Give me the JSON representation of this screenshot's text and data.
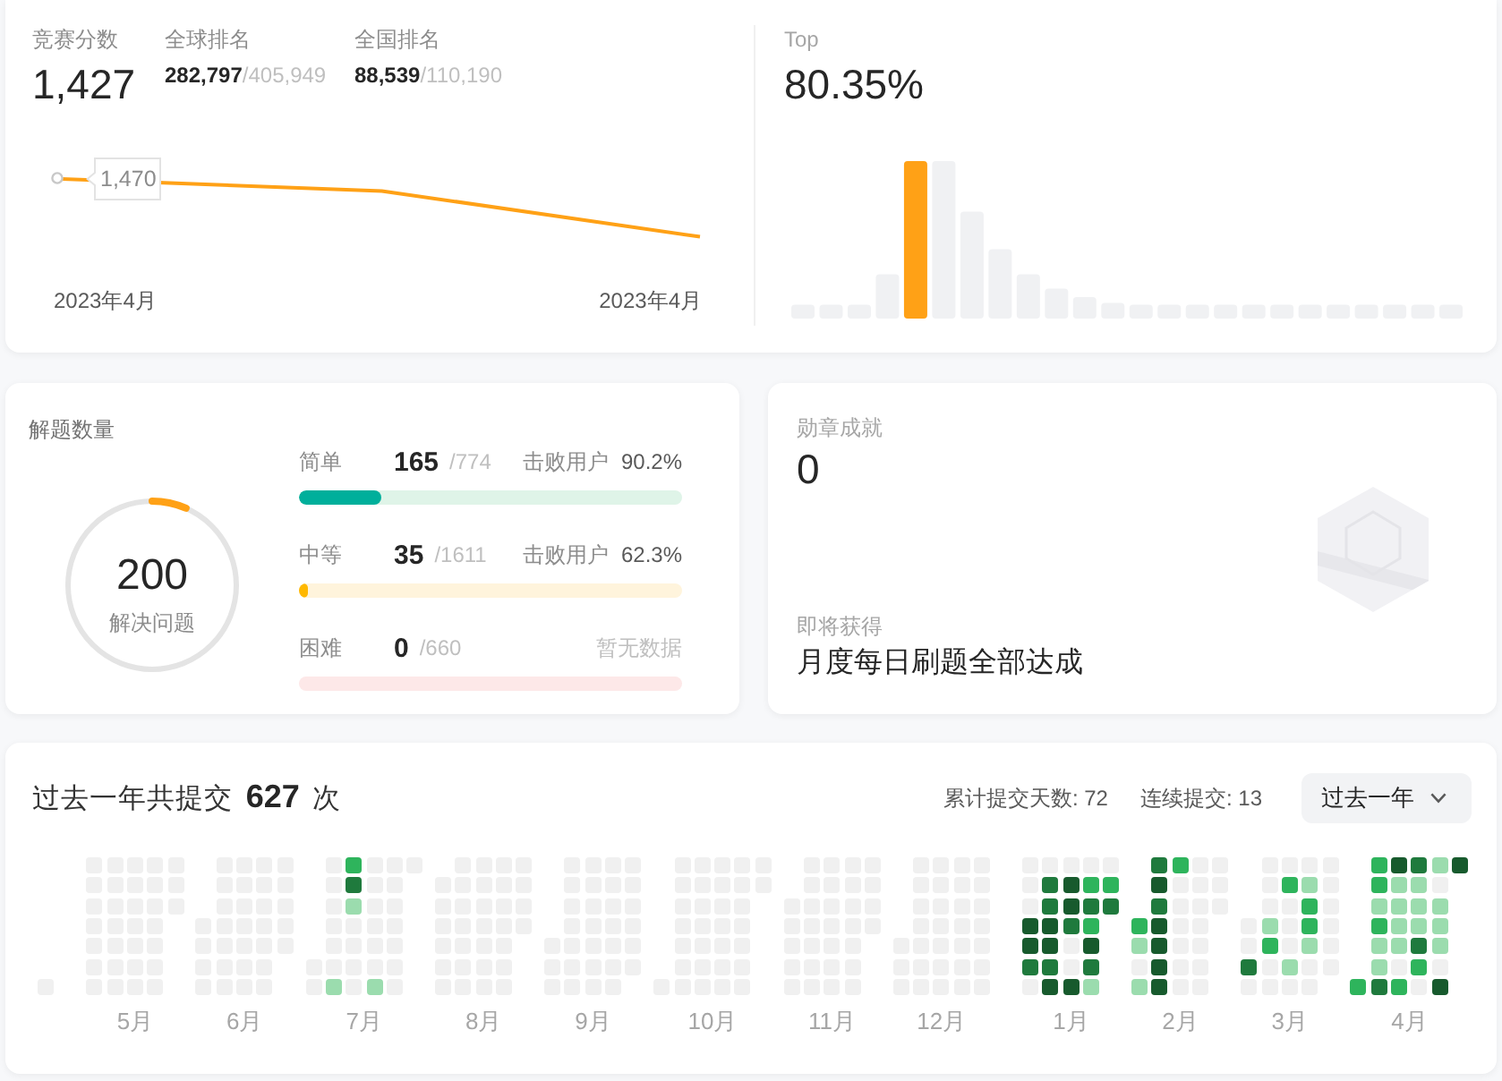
{
  "rating": {
    "label": "竞赛分数",
    "value": "1,427",
    "global_rank": {
      "label": "全球排名",
      "value": "**282,797**/405,949"
    },
    "national_rank": {
      "label": "全国排名",
      "value": "**88,539**/110,190"
    },
    "chart": {
      "tooltip": "1,470",
      "x_labels": [
        "2023年4月",
        "2023年4月"
      ]
    }
  },
  "top_percent": {
    "label": "Top",
    "value": "80.35%"
  },
  "solved": {
    "title": "解题数量",
    "count": "200",
    "caption": "解决问题",
    "level": 0.066,
    "difficulties": [
      {
        "kind": "easy",
        "label": "简单",
        "count": "165",
        "total": "/774",
        "beats_label": "击败用户",
        "beats": "90.2%",
        "level": 0.213
      },
      {
        "kind": "medium",
        "label": "中等",
        "count": "35",
        "total": "/1611",
        "beats_label": "击败用户",
        "beats": "62.3%",
        "level": 0.022
      },
      {
        "kind": "hard",
        "label": "困难",
        "count": "0",
        "total": "/660",
        "no_data": "暂无数据"
      }
    ]
  },
  "badges": {
    "title": "勋章成就",
    "count": "0",
    "upcoming_label": "即将获得",
    "upcoming": "月度每日刷题全部达成"
  },
  "submissions": {
    "title": "过去一年共提交 **627** 次",
    "total_days": "累计提交天数: 72",
    "streak": "连续提交: 13",
    "range": "过去一年",
    "months": [
      {
        "weeks": [
          [
            {
              "color": "#f0f0f0"
            }
          ]
        ]
      },
      {
        "label": "5月",
        "weeks": [
          [
            {
              "color": "#f0f0f0"
            },
            {
              "color": "#f0f0f0"
            },
            {
              "color": "#f0f0f0"
            },
            {
              "color": "#f0f0f0"
            },
            {
              "color": "#f0f0f0"
            },
            {
              "color": "#f0f0f0"
            },
            {
              "color": "#f0f0f0"
            }
          ],
          [
            {
              "color": "#f0f0f0"
            },
            {
              "color": "#f0f0f0"
            },
            {
              "color": "#f0f0f0"
            },
            {
              "color": "#f0f0f0"
            },
            {
              "color": "#f0f0f0"
            },
            {
              "color": "#f0f0f0"
            },
            {
              "color": "#f0f0f0"
            }
          ],
          [
            {
              "color": "#f0f0f0"
            },
            {
              "color": "#f0f0f0"
            },
            {
              "color": "#f0f0f0"
            },
            {
              "color": "#f0f0f0"
            },
            {
              "color": "#f0f0f0"
            },
            {
              "color": "#f0f0f0"
            },
            {
              "color": "#f0f0f0"
            }
          ],
          [
            {
              "color": "#f0f0f0"
            },
            {
              "color": "#f0f0f0"
            },
            {
              "color": "#f0f0f0"
            },
            {
              "color": "#f0f0f0"
            },
            {
              "color": "#f0f0f0"
            },
            {
              "color": "#f0f0f0"
            },
            {
              "color": "#f0f0f0"
            }
          ],
          [
            {
              "color": "#f0f0f0"
            },
            {
              "color": "#f0f0f0"
            },
            {
              "color": "#f0f0f0"
            }
          ]
        ]
      },
      {
        "label": "6月",
        "weeks": [
          [
            {
              "color": "#f0f0f0"
            },
            {
              "color": "#f0f0f0"
            },
            {
              "color": "#f0f0f0"
            },
            {
              "color": "#f0f0f0"
            }
          ],
          [
            {
              "color": "#f0f0f0"
            },
            {
              "color": "#f0f0f0"
            },
            {
              "color": "#f0f0f0"
            },
            {
              "color": "#f0f0f0"
            },
            {
              "color": "#f0f0f0"
            },
            {
              "color": "#f0f0f0"
            },
            {
              "color": "#f0f0f0"
            }
          ],
          [
            {
              "color": "#f0f0f0"
            },
            {
              "color": "#f0f0f0"
            },
            {
              "color": "#f0f0f0"
            },
            {
              "color": "#f0f0f0"
            },
            {
              "color": "#f0f0f0"
            },
            {
              "color": "#f0f0f0"
            },
            {
              "color": "#f0f0f0"
            }
          ],
          [
            {
              "color": "#f0f0f0"
            },
            {
              "color": "#f0f0f0"
            },
            {
              "color": "#f0f0f0"
            },
            {
              "color": "#f0f0f0"
            },
            {
              "color": "#f0f0f0"
            },
            {
              "color": "#f0f0f0"
            },
            {
              "color": "#f0f0f0"
            }
          ],
          [
            {
              "color": "#f0f0f0"
            },
            {
              "color": "#f0f0f0"
            },
            {
              "color": "#f0f0f0"
            },
            {
              "color": "#f0f0f0"
            },
            {
              "color": "#f0f0f0"
            }
          ]
        ]
      },
      {
        "label": "7月",
        "weeks": [
          [
            {
              "color": "#f0f0f0"
            },
            {
              "color": "#f0f0f0"
            }
          ],
          [
            {
              "color": "#f0f0f0"
            },
            {
              "color": "#f0f0f0"
            },
            {
              "color": "#f0f0f0"
            },
            {
              "color": "#f0f0f0"
            },
            {
              "color": "#f0f0f0"
            },
            {
              "color": "#f0f0f0"
            },
            {
              "color": "#9bdcae"
            }
          ],
          [
            {
              "color": "#2eb45c"
            },
            {
              "color": "#1f7a3d"
            },
            {
              "color": "#9bdcae"
            },
            {
              "color": "#f0f0f0"
            },
            {
              "color": "#f0f0f0"
            },
            {
              "color": "#f0f0f0"
            },
            {
              "color": "#f0f0f0"
            }
          ],
          [
            {
              "color": "#f0f0f0"
            },
            {
              "color": "#f0f0f0"
            },
            {
              "color": "#f0f0f0"
            },
            {
              "color": "#f0f0f0"
            },
            {
              "color": "#f0f0f0"
            },
            {
              "color": "#f0f0f0"
            },
            {
              "color": "#9bdcae"
            }
          ],
          [
            {
              "color": "#f0f0f0"
            },
            {
              "color": "#f0f0f0"
            },
            {
              "color": "#f0f0f0"
            },
            {
              "color": "#f0f0f0"
            },
            {
              "color": "#f0f0f0"
            },
            {
              "color": "#f0f0f0"
            },
            {
              "color": "#f0f0f0"
            }
          ],
          [
            {
              "color": "#f0f0f0"
            }
          ]
        ]
      },
      {
        "label": "8月",
        "weeks": [
          [
            {
              "color": "#f0f0f0"
            },
            {
              "color": "#f0f0f0"
            },
            {
              "color": "#f0f0f0"
            },
            {
              "color": "#f0f0f0"
            },
            {
              "color": "#f0f0f0"
            },
            {
              "color": "#f0f0f0"
            }
          ],
          [
            {
              "color": "#f0f0f0"
            },
            {
              "color": "#f0f0f0"
            },
            {
              "color": "#f0f0f0"
            },
            {
              "color": "#f0f0f0"
            },
            {
              "color": "#f0f0f0"
            },
            {
              "color": "#f0f0f0"
            },
            {
              "color": "#f0f0f0"
            }
          ],
          [
            {
              "color": "#f0f0f0"
            },
            {
              "color": "#f0f0f0"
            },
            {
              "color": "#f0f0f0"
            },
            {
              "color": "#f0f0f0"
            },
            {
              "color": "#f0f0f0"
            },
            {
              "color": "#f0f0f0"
            },
            {
              "color": "#f0f0f0"
            }
          ],
          [
            {
              "color": "#f0f0f0"
            },
            {
              "color": "#f0f0f0"
            },
            {
              "color": "#f0f0f0"
            },
            {
              "color": "#f0f0f0"
            },
            {
              "color": "#f0f0f0"
            },
            {
              "color": "#f0f0f0"
            },
            {
              "color": "#f0f0f0"
            }
          ],
          [
            {
              "color": "#f0f0f0"
            },
            {
              "color": "#f0f0f0"
            },
            {
              "color": "#f0f0f0"
            },
            {
              "color": "#f0f0f0"
            }
          ]
        ]
      },
      {
        "label": "9月",
        "weeks": [
          [
            {
              "color": "#f0f0f0"
            },
            {
              "color": "#f0f0f0"
            },
            {
              "color": "#f0f0f0"
            }
          ],
          [
            {
              "color": "#f0f0f0"
            },
            {
              "color": "#f0f0f0"
            },
            {
              "color": "#f0f0f0"
            },
            {
              "color": "#f0f0f0"
            },
            {
              "color": "#f0f0f0"
            },
            {
              "color": "#f0f0f0"
            },
            {
              "color": "#f0f0f0"
            }
          ],
          [
            {
              "color": "#f0f0f0"
            },
            {
              "color": "#f0f0f0"
            },
            {
              "color": "#f0f0f0"
            },
            {
              "color": "#f0f0f0"
            },
            {
              "color": "#f0f0f0"
            },
            {
              "color": "#f0f0f0"
            },
            {
              "color": "#f0f0f0"
            }
          ],
          [
            {
              "color": "#f0f0f0"
            },
            {
              "color": "#f0f0f0"
            },
            {
              "color": "#f0f0f0"
            },
            {
              "color": "#f0f0f0"
            },
            {
              "color": "#f0f0f0"
            },
            {
              "color": "#f0f0f0"
            },
            {
              "color": "#f0f0f0"
            }
          ],
          [
            {
              "color": "#f0f0f0"
            },
            {
              "color": "#f0f0f0"
            },
            {
              "color": "#f0f0f0"
            },
            {
              "color": "#f0f0f0"
            },
            {
              "color": "#f0f0f0"
            },
            {
              "color": "#f0f0f0"
            }
          ]
        ]
      },
      {
        "label": "10月",
        "weeks": [
          [
            {
              "color": "#f0f0f0"
            }
          ],
          [
            {
              "color": "#f0f0f0"
            },
            {
              "color": "#f0f0f0"
            },
            {
              "color": "#f0f0f0"
            },
            {
              "color": "#f0f0f0"
            },
            {
              "color": "#f0f0f0"
            },
            {
              "color": "#f0f0f0"
            },
            {
              "color": "#f0f0f0"
            }
          ],
          [
            {
              "color": "#f0f0f0"
            },
            {
              "color": "#f0f0f0"
            },
            {
              "color": "#f0f0f0"
            },
            {
              "color": "#f0f0f0"
            },
            {
              "color": "#f0f0f0"
            },
            {
              "color": "#f0f0f0"
            },
            {
              "color": "#f0f0f0"
            }
          ],
          [
            {
              "color": "#f0f0f0"
            },
            {
              "color": "#f0f0f0"
            },
            {
              "color": "#f0f0f0"
            },
            {
              "color": "#f0f0f0"
            },
            {
              "color": "#f0f0f0"
            },
            {
              "color": "#f0f0f0"
            },
            {
              "color": "#f0f0f0"
            }
          ],
          [
            {
              "color": "#f0f0f0"
            },
            {
              "color": "#f0f0f0"
            },
            {
              "color": "#f0f0f0"
            },
            {
              "color": "#f0f0f0"
            },
            {
              "color": "#f0f0f0"
            },
            {
              "color": "#f0f0f0"
            },
            {
              "color": "#f0f0f0"
            }
          ],
          [
            {
              "color": "#f0f0f0"
            },
            {
              "color": "#f0f0f0"
            }
          ]
        ]
      },
      {
        "label": "11月",
        "weeks": [
          [
            {
              "color": "#f0f0f0"
            },
            {
              "color": "#f0f0f0"
            },
            {
              "color": "#f0f0f0"
            },
            {
              "color": "#f0f0f0"
            },
            {
              "color": "#f0f0f0"
            }
          ],
          [
            {
              "color": "#f0f0f0"
            },
            {
              "color": "#f0f0f0"
            },
            {
              "color": "#f0f0f0"
            },
            {
              "color": "#f0f0f0"
            },
            {
              "color": "#f0f0f0"
            },
            {
              "color": "#f0f0f0"
            },
            {
              "color": "#f0f0f0"
            }
          ],
          [
            {
              "color": "#f0f0f0"
            },
            {
              "color": "#f0f0f0"
            },
            {
              "color": "#f0f0f0"
            },
            {
              "color": "#f0f0f0"
            },
            {
              "color": "#f0f0f0"
            },
            {
              "color": "#f0f0f0"
            },
            {
              "color": "#f0f0f0"
            }
          ],
          [
            {
              "color": "#f0f0f0"
            },
            {
              "color": "#f0f0f0"
            },
            {
              "color": "#f0f0f0"
            },
            {
              "color": "#f0f0f0"
            },
            {
              "color": "#f0f0f0"
            },
            {
              "color": "#f0f0f0"
            },
            {
              "color": "#f0f0f0"
            }
          ],
          [
            {
              "color": "#f0f0f0"
            },
            {
              "color": "#f0f0f0"
            },
            {
              "color": "#f0f0f0"
            },
            {
              "color": "#f0f0f0"
            }
          ]
        ]
      },
      {
        "label": "12月",
        "weeks": [
          [
            {
              "color": "#f0f0f0"
            },
            {
              "color": "#f0f0f0"
            },
            {
              "color": "#f0f0f0"
            }
          ],
          [
            {
              "color": "#f0f0f0"
            },
            {
              "color": "#f0f0f0"
            },
            {
              "color": "#f0f0f0"
            },
            {
              "color": "#f0f0f0"
            },
            {
              "color": "#f0f0f0"
            },
            {
              "color": "#f0f0f0"
            },
            {
              "color": "#f0f0f0"
            }
          ],
          [
            {
              "color": "#f0f0f0"
            },
            {
              "color": "#f0f0f0"
            },
            {
              "color": "#f0f0f0"
            },
            {
              "color": "#f0f0f0"
            },
            {
              "color": "#f0f0f0"
            },
            {
              "color": "#f0f0f0"
            },
            {
              "color": "#f0f0f0"
            }
          ],
          [
            {
              "color": "#f0f0f0"
            },
            {
              "color": "#f0f0f0"
            },
            {
              "color": "#f0f0f0"
            },
            {
              "color": "#f0f0f0"
            },
            {
              "color": "#f0f0f0"
            },
            {
              "color": "#f0f0f0"
            },
            {
              "color": "#f0f0f0"
            }
          ],
          [
            {
              "color": "#f0f0f0"
            },
            {
              "color": "#f0f0f0"
            },
            {
              "color": "#f0f0f0"
            },
            {
              "color": "#f0f0f0"
            },
            {
              "color": "#f0f0f0"
            },
            {
              "color": "#f0f0f0"
            },
            {
              "color": "#f0f0f0"
            }
          ]
        ]
      },
      {
        "label": "1月",
        "weeks": [
          [
            {
              "color": "#f0f0f0"
            },
            {
              "color": "#f0f0f0"
            },
            {
              "color": "#f0f0f0"
            },
            {
              "color": "#175a2d"
            },
            {
              "color": "#175a2d"
            },
            {
              "color": "#1f7a3d"
            },
            {
              "color": "#f0f0f0"
            }
          ],
          [
            {
              "color": "#f0f0f0"
            },
            {
              "color": "#1f7a3d"
            },
            {
              "color": "#1f7a3d"
            },
            {
              "color": "#175a2d"
            },
            {
              "color": "#175a2d"
            },
            {
              "color": "#1f7a3d"
            },
            {
              "color": "#175a2d"
            }
          ],
          [
            {
              "color": "#f0f0f0"
            },
            {
              "color": "#175a2d"
            },
            {
              "color": "#175a2d"
            },
            {
              "color": "#1f7a3d"
            },
            {
              "color": "#f0f0f0"
            },
            {
              "color": "#f0f0f0"
            },
            {
              "color": "#175a2d"
            }
          ],
          [
            {
              "color": "#f0f0f0"
            },
            {
              "color": "#2eb45c"
            },
            {
              "color": "#1f7a3d"
            },
            {
              "color": "#2eb45c"
            },
            {
              "color": "#175a2d"
            },
            {
              "color": "#1f7a3d"
            },
            {
              "color": "#9bdcae"
            }
          ],
          [
            {
              "color": "#f0f0f0"
            },
            {
              "color": "#2eb45c"
            },
            {
              "color": "#1f7a3d"
            }
          ]
        ]
      },
      {
        "label": "2月",
        "weeks": [
          [
            {
              "color": "#2eb45c"
            },
            {
              "color": "#9bdcae"
            },
            {
              "color": "#f0f0f0"
            },
            {
              "color": "#9bdcae"
            }
          ],
          [
            {
              "color": "#1f7a3d"
            },
            {
              "color": "#175a2d"
            },
            {
              "color": "#1f7a3d"
            },
            {
              "color": "#175a2d"
            },
            {
              "color": "#175a2d"
            },
            {
              "color": "#175a2d"
            },
            {
              "color": "#175a2d"
            }
          ],
          [
            {
              "color": "#2eb45c"
            },
            {
              "color": "#f0f0f0"
            },
            {
              "color": "#f0f0f0"
            },
            {
              "color": "#f0f0f0"
            },
            {
              "color": "#f0f0f0"
            },
            {
              "color": "#f0f0f0"
            },
            {
              "color": "#f0f0f0"
            }
          ],
          [
            {
              "color": "#f0f0f0"
            },
            {
              "color": "#f0f0f0"
            },
            {
              "color": "#f0f0f0"
            },
            {
              "color": "#f0f0f0"
            },
            {
              "color": "#f0f0f0"
            },
            {
              "color": "#f0f0f0"
            },
            {
              "color": "#f0f0f0"
            }
          ],
          [
            {
              "color": "#f0f0f0"
            },
            {
              "color": "#f0f0f0"
            },
            {
              "color": "#f0f0f0"
            }
          ]
        ]
      },
      {
        "label": "3月",
        "weeks": [
          [
            {
              "color": "#f0f0f0"
            },
            {
              "color": "#f0f0f0"
            },
            {
              "color": "#1f7a3d"
            },
            {
              "color": "#f0f0f0"
            }
          ],
          [
            {
              "color": "#f0f0f0"
            },
            {
              "color": "#f0f0f0"
            },
            {
              "color": "#f0f0f0"
            },
            {
              "color": "#9bdcae"
            },
            {
              "color": "#2eb45c"
            },
            {
              "color": "#f0f0f0"
            },
            {
              "color": "#f0f0f0"
            }
          ],
          [
            {
              "color": "#f0f0f0"
            },
            {
              "color": "#2eb45c"
            },
            {
              "color": "#f0f0f0"
            },
            {
              "color": "#f0f0f0"
            },
            {
              "color": "#f0f0f0"
            },
            {
              "color": "#9bdcae"
            },
            {
              "color": "#f0f0f0"
            }
          ],
          [
            {
              "color": "#f0f0f0"
            },
            {
              "color": "#9bdcae"
            },
            {
              "color": "#2eb45c"
            },
            {
              "color": "#2eb45c"
            },
            {
              "color": "#9bdcae"
            },
            {
              "color": "#f0f0f0"
            },
            {
              "color": "#f0f0f0"
            }
          ],
          [
            {
              "color": "#f0f0f0"
            },
            {
              "color": "#f0f0f0"
            },
            {
              "color": "#f0f0f0"
            },
            {
              "color": "#f0f0f0"
            },
            {
              "color": "#f0f0f0"
            },
            {
              "color": "#f0f0f0"
            }
          ]
        ]
      },
      {
        "label": "4月",
        "weeks": [
          [
            {
              "color": "#2eb45c"
            }
          ],
          [
            {
              "color": "#2eb45c"
            },
            {
              "color": "#2eb45c"
            },
            {
              "color": "#9bdcae"
            },
            {
              "color": "#2eb45c"
            },
            {
              "color": "#9bdcae"
            },
            {
              "color": "#9bdcae"
            },
            {
              "color": "#1f7a3d"
            }
          ],
          [
            {
              "color": "#175a2d"
            },
            {
              "color": "#9bdcae"
            },
            {
              "color": "#9bdcae"
            },
            {
              "color": "#9bdcae"
            },
            {
              "color": "#9bdcae"
            },
            {
              "color": "#f0f0f0"
            },
            {
              "color": "#2eb45c"
            }
          ],
          [
            {
              "color": "#1f7a3d"
            },
            {
              "color": "#9bdcae"
            },
            {
              "color": "#9bdcae"
            },
            {
              "color": "#9bdcae"
            },
            {
              "color": "#1f7a3d"
            },
            {
              "color": "#2eb45c"
            },
            {
              "color": "#f0f0f0"
            }
          ],
          [
            {
              "color": "#9bdcae"
            },
            {
              "color": "#f0f0f0"
            },
            {
              "color": "#9bdcae"
            },
            {
              "color": "#9bdcae"
            },
            {
              "color": "#9bdcae"
            },
            {
              "color": "#f0f0f0"
            },
            {
              "color": "#175a2d"
            }
          ],
          [
            {
              "color": "#175a2d"
            }
          ]
        ]
      }
    ]
  }
}
